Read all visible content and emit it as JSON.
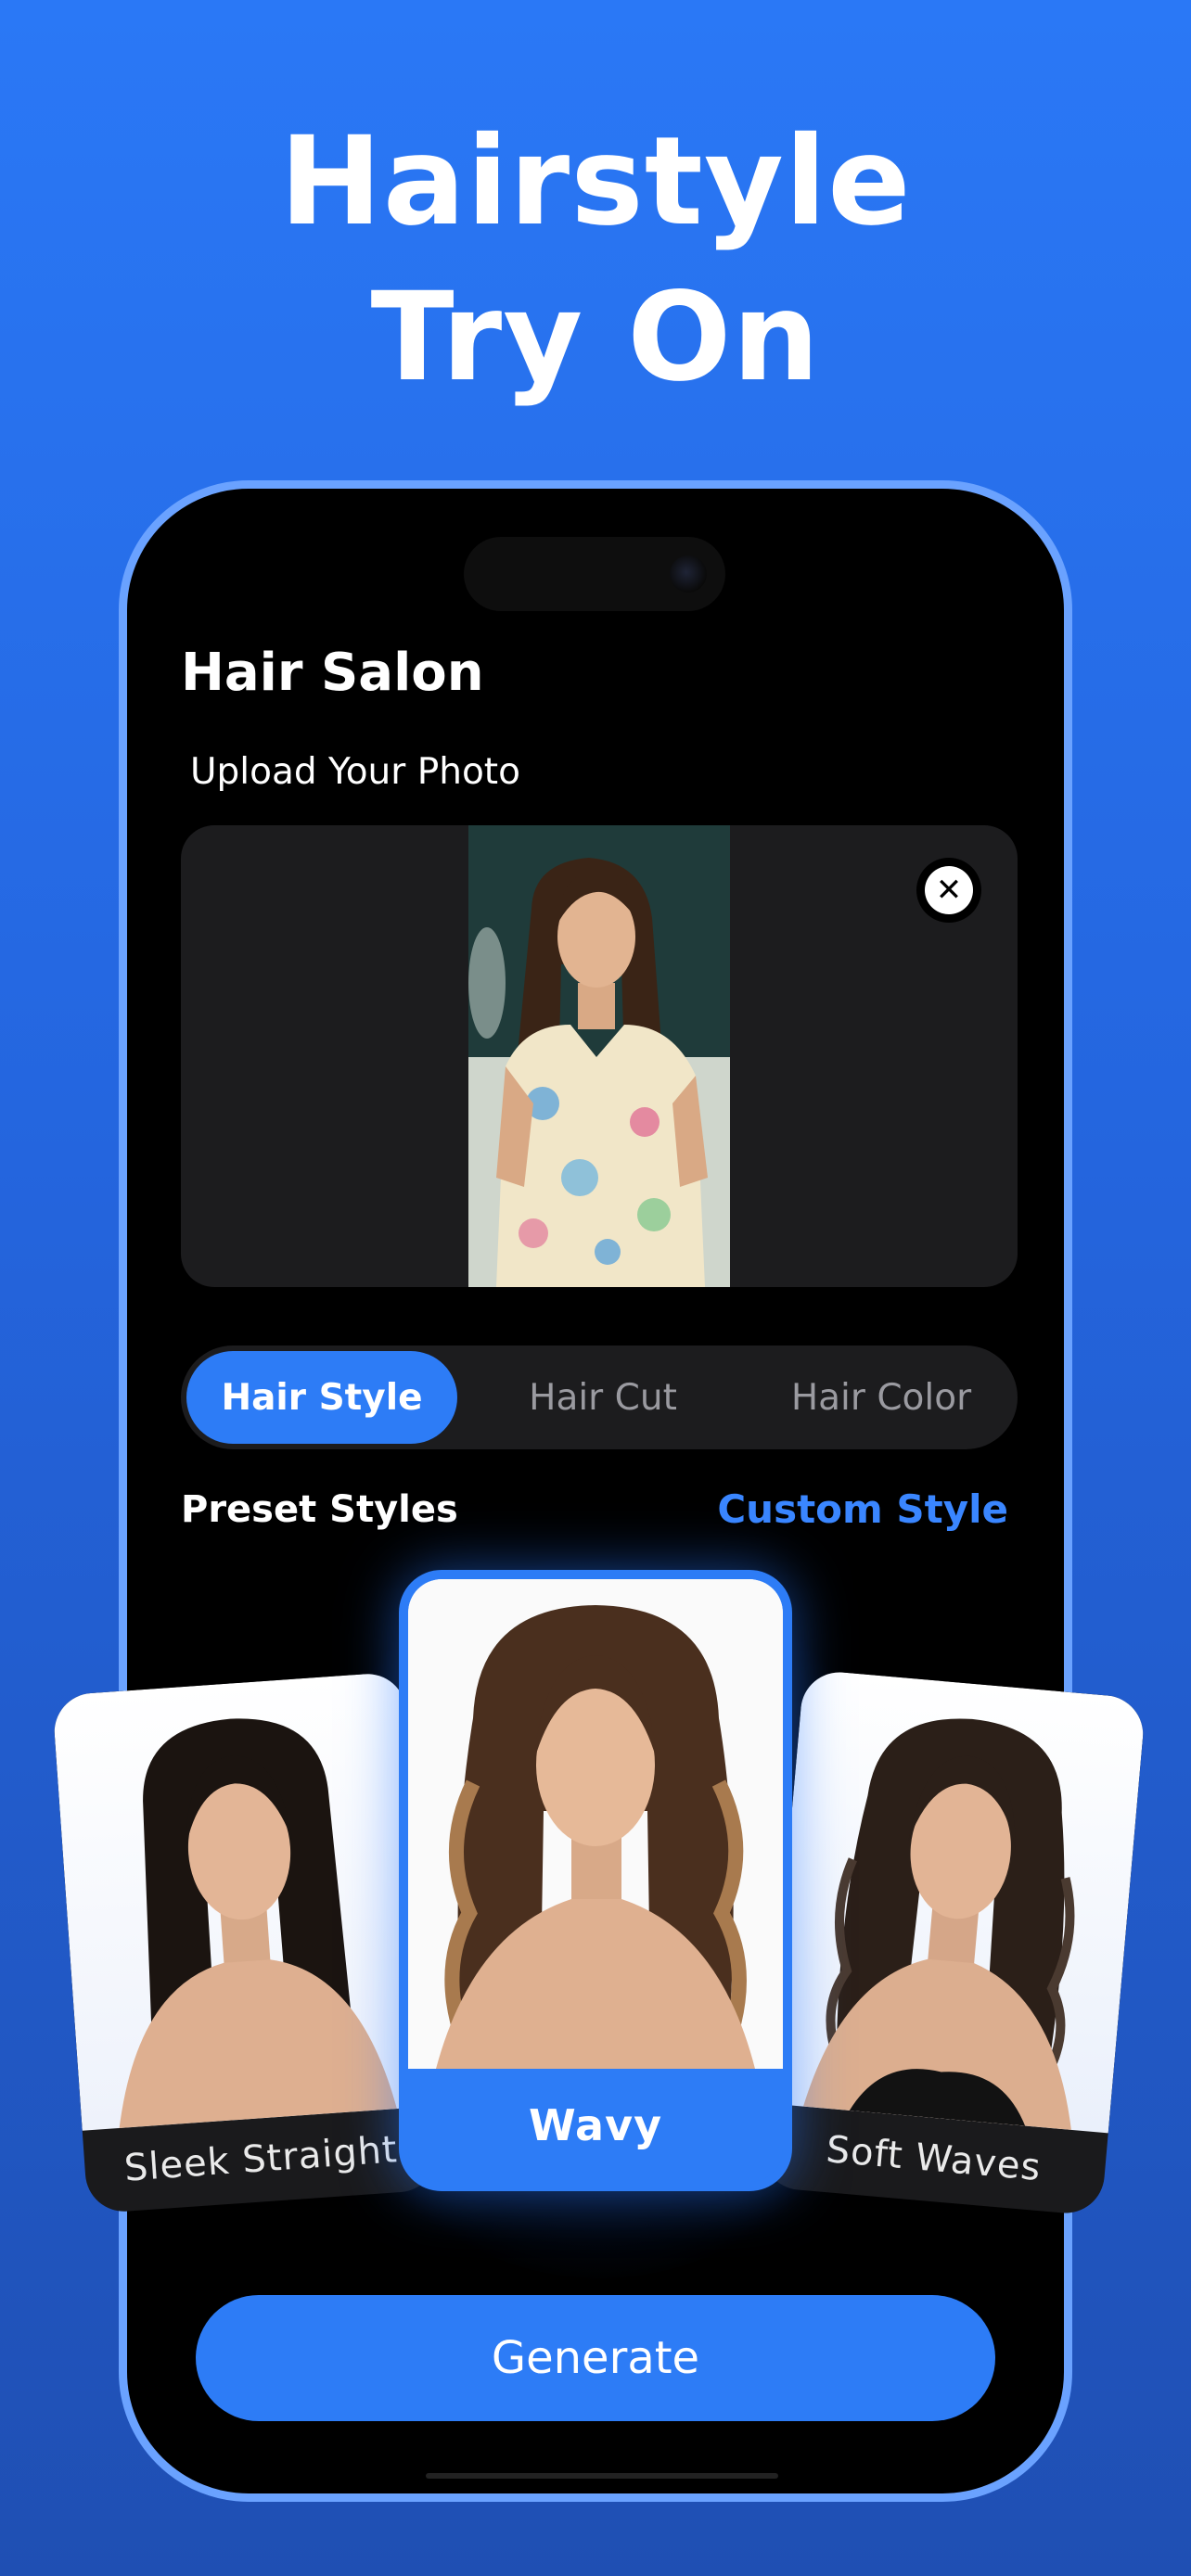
{
  "headline": {
    "line1": "Hairstyle",
    "line2": "Try On"
  },
  "app": {
    "title": "Hair Salon",
    "upload_label": "Upload Your Photo",
    "close_glyph": "✕"
  },
  "tabs": [
    {
      "label": "Hair Style",
      "active": true
    },
    {
      "label": "Hair Cut",
      "active": false
    },
    {
      "label": "Hair Color",
      "active": false
    }
  ],
  "presets": {
    "title": "Preset Styles",
    "custom_link": "Custom Style",
    "cards": [
      {
        "label": "Sleek Straight",
        "selected": false
      },
      {
        "label": "Wavy",
        "selected": true
      },
      {
        "label": "Soft Waves",
        "selected": false
      }
    ]
  },
  "generate_label": "Generate",
  "colors": {
    "accent": "#2d7cf6",
    "link": "#3a86ff",
    "background_top": "#2a78f6",
    "phone_frame": "#6aa2ff"
  },
  "icons": [
    "close-icon"
  ]
}
